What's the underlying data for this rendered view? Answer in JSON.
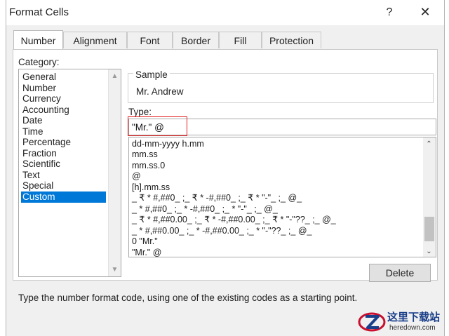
{
  "window": {
    "title": "Format Cells",
    "help_label": "?",
    "close_label": "✕"
  },
  "tabs": [
    {
      "label": "Number",
      "active": true
    },
    {
      "label": "Alignment"
    },
    {
      "label": "Font"
    },
    {
      "label": "Border"
    },
    {
      "label": "Fill"
    },
    {
      "label": "Protection"
    }
  ],
  "category": {
    "label": "Category:",
    "items": [
      "General",
      "Number",
      "Currency",
      "Accounting",
      "Date",
      "Time",
      "Percentage",
      "Fraction",
      "Scientific",
      "Text",
      "Special",
      "Custom"
    ],
    "selected": "Custom"
  },
  "sample": {
    "label": "Sample",
    "value": "Mr. Andrew"
  },
  "type": {
    "label": "Type:",
    "value": "\"Mr.\" @",
    "formats": [
      "dd-mm-yyyy h.mm",
      "mm.ss",
      "mm.ss.0",
      "@",
      "[h].mm.ss",
      "_ ₹ * #,##0_ ;_ ₹ * -#,##0_ ;_ ₹ * \"-\"_ ;_ @_",
      "_ * #,##0_ ;_ * -#,##0_ ;_ * \"-\"_ ;_ @_",
      "_ ₹ * #,##0.00_ ;_ ₹ * -#,##0.00_ ;_ ₹ * \"-\"??_ ;_ @_",
      "_ * #,##0.00_ ;_ * -#,##0.00_ ;_ * \"-\"??_ ;_ @_",
      "0 \"Mr.\"",
      "\"Mr.\" @"
    ]
  },
  "buttons": {
    "delete_label": "Delete"
  },
  "hint": "Type the number format code, using one of the existing codes as a starting point.",
  "watermark": {
    "line1": "这里下载站",
    "line2": "heredown.com"
  },
  "colors": {
    "accent": "#0078d7",
    "highlight": "#e02020"
  }
}
